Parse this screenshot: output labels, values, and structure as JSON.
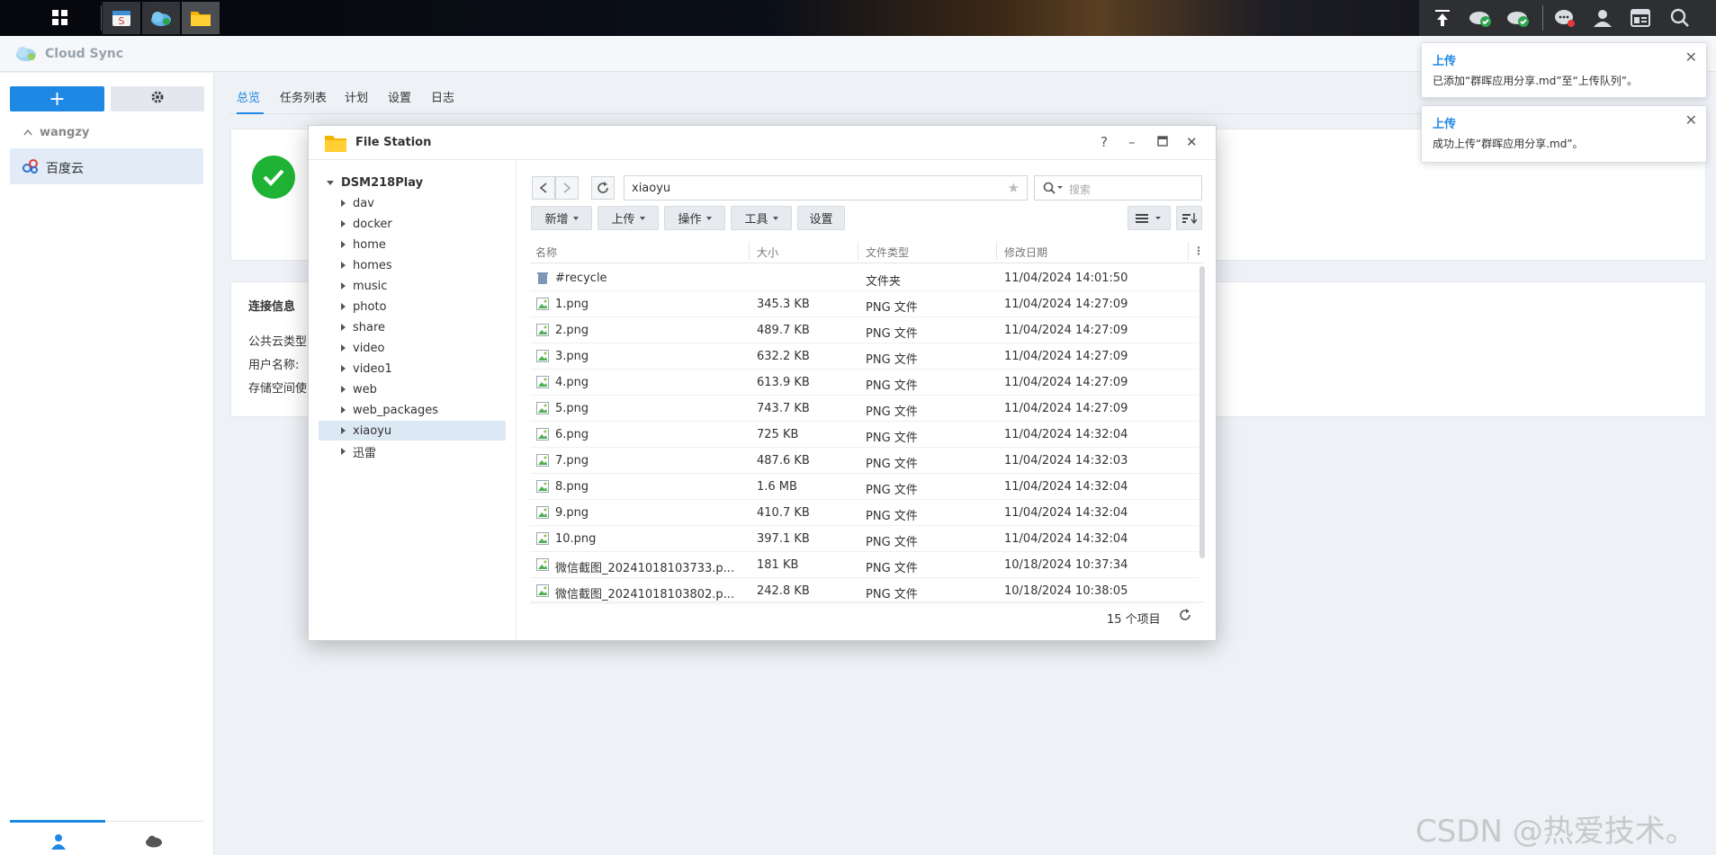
{
  "taskbar": {
    "left_apps": [
      "main-menu",
      "package-center",
      "cloud-sync",
      "file-station"
    ],
    "right_icons": [
      "upload-queue",
      "cloud-sync-status",
      "cloud-status",
      "messages",
      "user",
      "widgets",
      "search"
    ]
  },
  "app": {
    "title": "Cloud Sync",
    "group": "wangzy",
    "account": "百度云",
    "tabs": [
      "总览",
      "任务列表",
      "计划",
      "设置",
      "日志"
    ],
    "info_title": "连接信息",
    "info_labels": [
      "公共云类型",
      "用户名称:",
      "存储空间使"
    ]
  },
  "notifications": [
    {
      "title": "上传",
      "body": "已添加“群晖应用分享.md”至“上传队列”。"
    },
    {
      "title": "上传",
      "body": "成功上传“群晖应用分享.md”。"
    }
  ],
  "file_station": {
    "title": "File Station",
    "tree_root": "DSM218Play",
    "tree": [
      "dav",
      "docker",
      "home",
      "homes",
      "music",
      "photo",
      "share",
      "video",
      "video1",
      "web",
      "web_packages",
      "xiaoyu",
      "迅雷"
    ],
    "selected_folder": "xiaoyu",
    "path": "xiaoyu",
    "search_placeholder": "搜索",
    "toolbar": {
      "new": "新增",
      "upload": "上传",
      "action": "操作",
      "tools": "工具",
      "settings": "设置"
    },
    "columns": [
      "名称",
      "大小",
      "文件类型",
      "修改日期"
    ],
    "rows": [
      {
        "name": "#recycle",
        "size": "",
        "type": "文件夹",
        "date": "11/04/2024 14:01:50",
        "icon": "recycle-icon"
      },
      {
        "name": "1.png",
        "size": "345.3 KB",
        "type": "PNG 文件",
        "date": "11/04/2024 14:27:09",
        "icon": "image-icon"
      },
      {
        "name": "2.png",
        "size": "489.7 KB",
        "type": "PNG 文件",
        "date": "11/04/2024 14:27:09",
        "icon": "image-icon"
      },
      {
        "name": "3.png",
        "size": "632.2 KB",
        "type": "PNG 文件",
        "date": "11/04/2024 14:27:09",
        "icon": "image-icon"
      },
      {
        "name": "4.png",
        "size": "613.9 KB",
        "type": "PNG 文件",
        "date": "11/04/2024 14:27:09",
        "icon": "image-icon"
      },
      {
        "name": "5.png",
        "size": "743.7 KB",
        "type": "PNG 文件",
        "date": "11/04/2024 14:27:09",
        "icon": "image-icon"
      },
      {
        "name": "6.png",
        "size": "725 KB",
        "type": "PNG 文件",
        "date": "11/04/2024 14:32:04",
        "icon": "image-icon"
      },
      {
        "name": "7.png",
        "size": "487.6 KB",
        "type": "PNG 文件",
        "date": "11/04/2024 14:32:03",
        "icon": "image-icon"
      },
      {
        "name": "8.png",
        "size": "1.6 MB",
        "type": "PNG 文件",
        "date": "11/04/2024 14:32:04",
        "icon": "image-icon"
      },
      {
        "name": "9.png",
        "size": "410.7 KB",
        "type": "PNG 文件",
        "date": "11/04/2024 14:32:04",
        "icon": "image-icon"
      },
      {
        "name": "10.png",
        "size": "397.1 KB",
        "type": "PNG 文件",
        "date": "11/04/2024 14:32:04",
        "icon": "image-icon"
      },
      {
        "name": "微信截图_20241018103733.p...",
        "size": "181 KB",
        "type": "PNG 文件",
        "date": "10/18/2024 10:37:34",
        "icon": "image-icon"
      },
      {
        "name": "微信截图_20241018103802.p...",
        "size": "242.8 KB",
        "type": "PNG 文件",
        "date": "10/18/2024 10:38:05",
        "icon": "image-icon"
      }
    ],
    "item_count": "15 个项目"
  },
  "watermark": "CSDN @热爱技术。",
  "colors": {
    "accent": "#1e88e5",
    "success": "#1fb335"
  }
}
